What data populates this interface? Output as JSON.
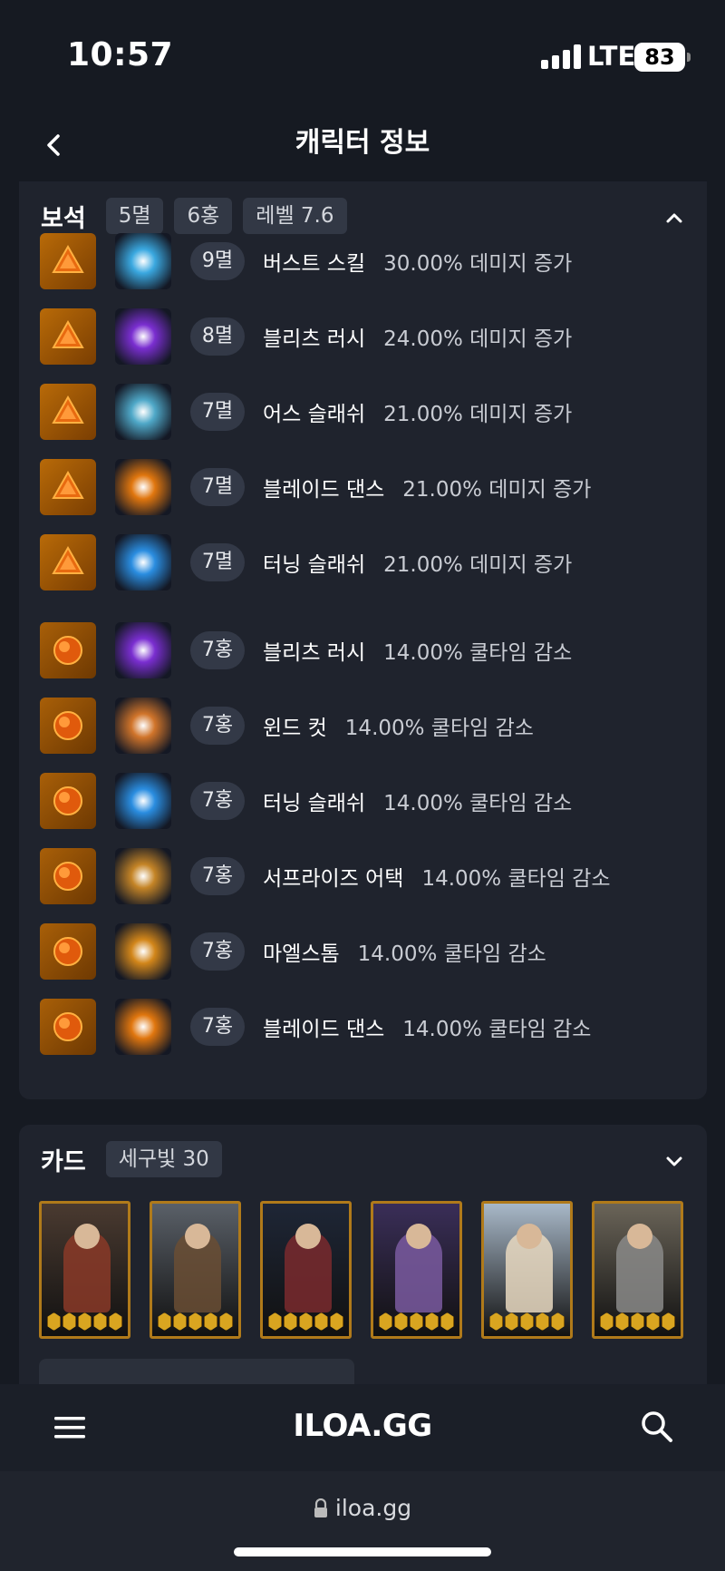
{
  "status": {
    "time": "10:57",
    "network": "LTE",
    "battery": "83"
  },
  "header": {
    "title": "캐릭터 정보"
  },
  "gems": {
    "title": "보석",
    "chips": [
      "5멸",
      "6홍",
      "레벨 7.6"
    ],
    "rows": [
      {
        "level": "9멸",
        "skill": "버스트 스킬",
        "effect": "30.00% 데미지 증가",
        "type": "dmg",
        "skill_color": "#3aa8e0"
      },
      {
        "level": "8멸",
        "skill": "블리츠 러시",
        "effect": "24.00% 데미지 증가",
        "type": "dmg",
        "skill_color": "#7a2ed0"
      },
      {
        "level": "7멸",
        "skill": "어스 슬래쉬",
        "effect": "21.00% 데미지 증가",
        "type": "dmg",
        "skill_color": "#4fa8c8"
      },
      {
        "level": "7멸",
        "skill": "블레이드 댄스",
        "effect": "21.00% 데미지 증가",
        "type": "dmg",
        "skill_color": "#e0760e"
      },
      {
        "level": "7멸",
        "skill": "터닝 슬래쉬",
        "effect": "21.00% 데미지 증가",
        "type": "dmg",
        "skill_color": "#2a8de0"
      },
      {
        "level": "7홍",
        "skill": "블리츠 러시",
        "effect": "14.00% 쿨타임 감소",
        "type": "cd",
        "skill_color": "#7a2ed0"
      },
      {
        "level": "7홍",
        "skill": "윈드 컷",
        "effect": "14.00% 쿨타임 감소",
        "type": "cd",
        "skill_color": "#d0742a"
      },
      {
        "level": "7홍",
        "skill": "터닝 슬래쉬",
        "effect": "14.00% 쿨타임 감소",
        "type": "cd",
        "skill_color": "#2a8de0"
      },
      {
        "level": "7홍",
        "skill": "서프라이즈 어택",
        "effect": "14.00% 쿨타임 감소",
        "type": "cd",
        "skill_color": "#c48426"
      },
      {
        "level": "7홍",
        "skill": "마엘스톰",
        "effect": "14.00% 쿨타임 감소",
        "type": "cd",
        "skill_color": "#d2861a"
      },
      {
        "level": "7홍",
        "skill": "블레이드 댄스",
        "effect": "14.00% 쿨타임 감소",
        "type": "cd",
        "skill_color": "#e0760e"
      }
    ]
  },
  "cards": {
    "title": "카드",
    "chips": [
      "세구빛 30"
    ],
    "items": [
      {
        "bg": "#4a3a30",
        "figure": "#8a3a28",
        "awaken": 5
      },
      {
        "bg": "#5a6068",
        "figure": "#6a4e34",
        "awaken": 5
      },
      {
        "bg": "#1e2636",
        "figure": "#7a2a2e",
        "awaken": 5
      },
      {
        "bg": "#3a2e58",
        "figure": "#7a5aa0",
        "awaken": 5
      },
      {
        "bg": "#a8b8c8",
        "figure": "#e8d8c0",
        "awaken": 5
      },
      {
        "bg": "#6a6458",
        "figure": "#8a8a88",
        "awaken": 5
      }
    ]
  },
  "bottom_nav": {
    "brand": "ILOA.GG"
  },
  "browser": {
    "url": "iloa.gg"
  }
}
